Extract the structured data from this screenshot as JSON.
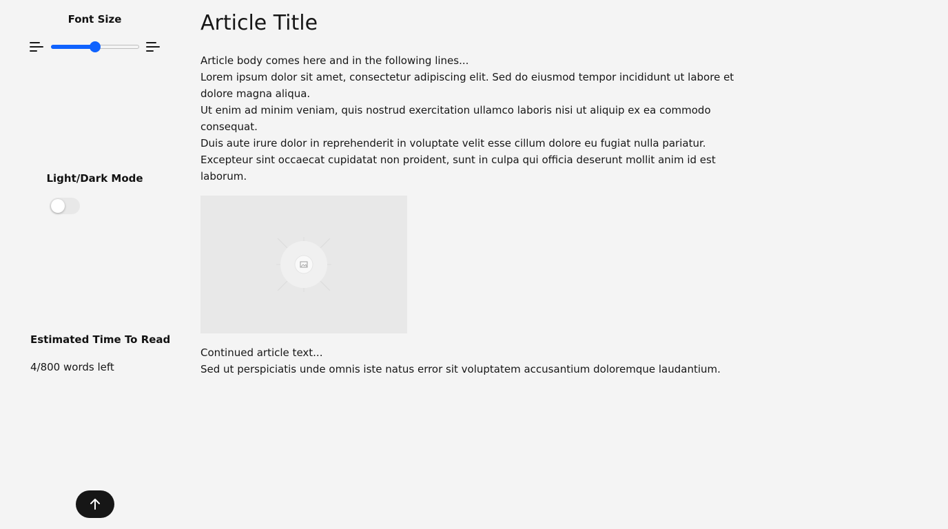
{
  "sidebar": {
    "font_size": {
      "heading": "Font Size",
      "level": 0.5,
      "accent_color": "#0f62fe"
    },
    "mode": {
      "heading": "Light/Dark Mode",
      "dark_mode_on": false
    },
    "reading_time": {
      "heading": "Estimated Time To Read",
      "words_left": "4/800 words left"
    },
    "back_to_top_icon": "arrow-up-icon"
  },
  "article": {
    "title": "Article Title",
    "paragraphs": [
      "Article body comes here and in the following lines...",
      "Lorem ipsum dolor sit amet, consectetur adipiscing elit. Sed do eiusmod tempor incididunt ut labore et dolore magna aliqua.",
      "Ut enim ad minim veniam, quis nostrud exercitation ullamco laboris nisi ut aliquip ex ea commodo consequat.",
      "Duis aute irure dolor in reprehenderit in voluptate velit esse cillum dolore eu fugiat nulla pariatur.",
      "Excepteur sint occaecat cupidatat non proident, sunt in culpa qui officia deserunt mollit anim id est laborum."
    ],
    "image_icon": "image-placeholder-icon",
    "continued": [
      "Continued article text...",
      "Sed ut perspiciatis unde omnis iste natus error sit voluptatem accusantium doloremque laudantium."
    ]
  }
}
